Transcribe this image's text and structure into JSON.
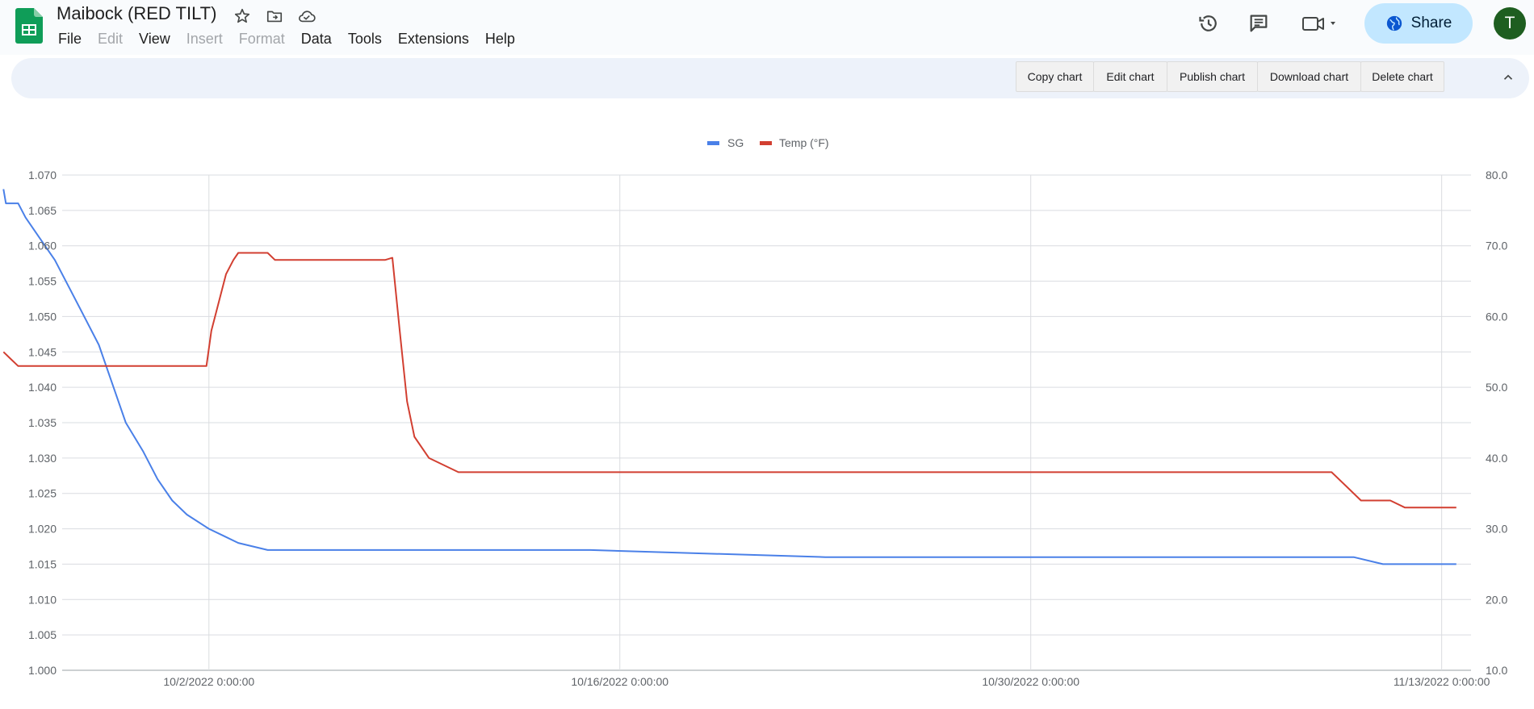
{
  "app": {
    "doc_title": "Maibock (RED TILT)",
    "menu": [
      {
        "label": "File",
        "enabled": true
      },
      {
        "label": "Edit",
        "enabled": false
      },
      {
        "label": "View",
        "enabled": true
      },
      {
        "label": "Insert",
        "enabled": false
      },
      {
        "label": "Format",
        "enabled": false
      },
      {
        "label": "Data",
        "enabled": true
      },
      {
        "label": "Tools",
        "enabled": true
      },
      {
        "label": "Extensions",
        "enabled": true
      },
      {
        "label": "Help",
        "enabled": true
      }
    ],
    "title_icons": [
      "star-icon",
      "move-to-folder-icon",
      "cloud-saved-icon"
    ],
    "right_icons": [
      "version-history-icon",
      "comments-icon",
      "meet-icon"
    ],
    "share_label": "Share",
    "avatar_initial": "T",
    "colors": {
      "share_bg": "#c2e7ff",
      "avatar_bg": "#1e5e20",
      "sheets_green": "#0f9d58"
    }
  },
  "chart_toolbar": {
    "buttons": [
      "Copy chart",
      "Edit chart",
      "Publish chart",
      "Download chart",
      "Delete chart"
    ],
    "collapse_icon": "chevron-up-icon"
  },
  "chart_data": {
    "type": "line",
    "legend_position": "top",
    "grid": true,
    "x_axis": {
      "type": "datetime",
      "min": "2022-09-27 00:00",
      "max": "2022-11-14 00:00",
      "tick_labels": [
        "10/2/2022 0:00:00",
        "10/16/2022 0:00:00",
        "10/30/2022 0:00:00",
        "11/13/2022 0:00:00"
      ]
    },
    "y_left": {
      "ylim": [
        1.0,
        1.07
      ],
      "ticks": [
        "1.000",
        "1.005",
        "1.010",
        "1.015",
        "1.020",
        "1.025",
        "1.030",
        "1.035",
        "1.040",
        "1.045",
        "1.050",
        "1.055",
        "1.060",
        "1.065",
        "1.070"
      ]
    },
    "y_right": {
      "ylim": [
        10.0,
        80.0
      ],
      "ticks": [
        "10.0",
        "20.0",
        "30.0",
        "40.0",
        "50.0",
        "60.0",
        "70.0",
        "80.0"
      ]
    },
    "series": [
      {
        "name": "SG",
        "axis": "left",
        "color": "#4a80e8",
        "points": [
          [
            "2022-09-25 00:00",
            1.068
          ],
          [
            "2022-09-25 02:00",
            1.066
          ],
          [
            "2022-09-25 12:00",
            1.066
          ],
          [
            "2022-09-25 18:00",
            1.064
          ],
          [
            "2022-09-26 06:00",
            1.061
          ],
          [
            "2022-09-26 18:00",
            1.058
          ],
          [
            "2022-09-27 06:00",
            1.054
          ],
          [
            "2022-09-27 18:00",
            1.05
          ],
          [
            "2022-09-28 06:00",
            1.046
          ],
          [
            "2022-09-28 18:00",
            1.04
          ],
          [
            "2022-09-29 04:00",
            1.035
          ],
          [
            "2022-09-29 18:00",
            1.031
          ],
          [
            "2022-09-30 06:00",
            1.027
          ],
          [
            "2022-09-30 18:00",
            1.024
          ],
          [
            "2022-10-01 06:00",
            1.022
          ],
          [
            "2022-10-02 00:00",
            1.02
          ],
          [
            "2022-10-02 12:00",
            1.019
          ],
          [
            "2022-10-03 00:00",
            1.018
          ],
          [
            "2022-10-04 00:00",
            1.017
          ],
          [
            "2022-10-10 00:00",
            1.017
          ],
          [
            "2022-10-15 00:00",
            1.017
          ],
          [
            "2022-10-23 00:00",
            1.016
          ],
          [
            "2022-11-10 00:00",
            1.016
          ],
          [
            "2022-11-11 00:00",
            1.015
          ],
          [
            "2022-11-13 12:00",
            1.015
          ]
        ]
      },
      {
        "name": "Temp (°F)",
        "axis": "right",
        "color": "#d23f31",
        "points": [
          [
            "2022-09-25 00:00",
            55.0
          ],
          [
            "2022-09-25 06:00",
            54.0
          ],
          [
            "2022-09-25 12:00",
            53.0
          ],
          [
            "2022-10-01 22:00",
            53.0
          ],
          [
            "2022-10-02 02:00",
            58.0
          ],
          [
            "2022-10-02 08:00",
            62.0
          ],
          [
            "2022-10-02 14:00",
            66.0
          ],
          [
            "2022-10-02 20:00",
            68.0
          ],
          [
            "2022-10-03 00:00",
            69.0
          ],
          [
            "2022-10-04 00:00",
            69.0
          ],
          [
            "2022-10-04 06:00",
            68.0
          ],
          [
            "2022-10-08 00:00",
            68.0
          ],
          [
            "2022-10-08 06:00",
            68.3
          ],
          [
            "2022-10-08 12:00",
            58.0
          ],
          [
            "2022-10-08 18:00",
            48.0
          ],
          [
            "2022-10-09 00:00",
            43.0
          ],
          [
            "2022-10-09 12:00",
            40.0
          ],
          [
            "2022-10-10 00:00",
            39.0
          ],
          [
            "2022-10-10 12:00",
            38.0
          ],
          [
            "2022-10-11 00:00",
            38.0
          ],
          [
            "2022-11-09 06:00",
            38.0
          ],
          [
            "2022-11-09 18:00",
            36.0
          ],
          [
            "2022-11-10 06:00",
            34.0
          ],
          [
            "2022-11-11 06:00",
            34.0
          ],
          [
            "2022-11-11 18:00",
            33.0
          ],
          [
            "2022-11-13 12:00",
            33.0
          ]
        ]
      }
    ]
  }
}
